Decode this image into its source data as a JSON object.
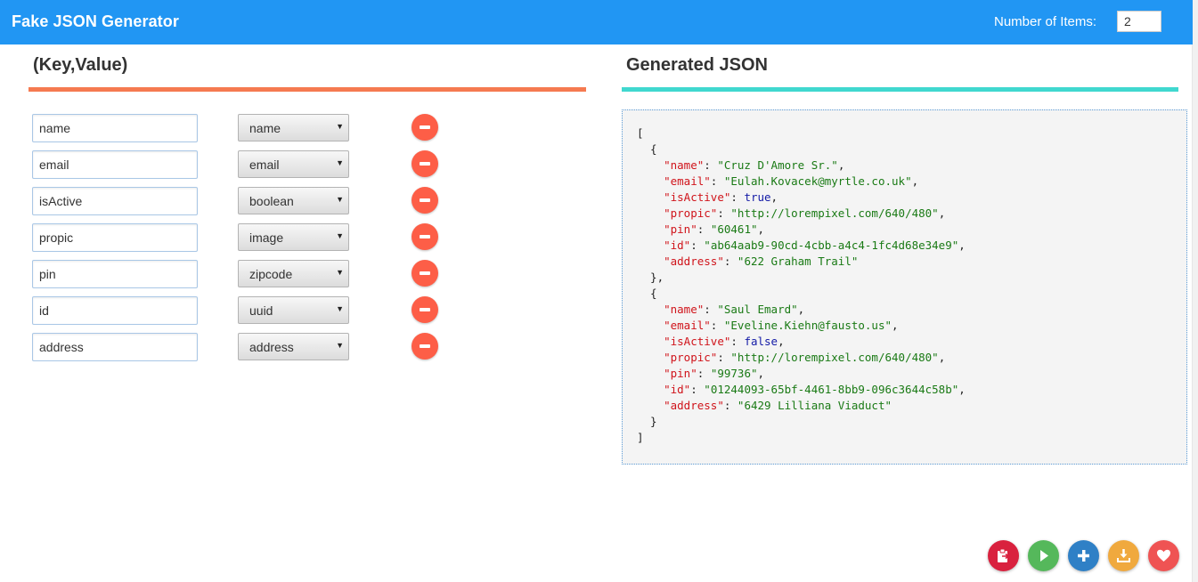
{
  "header": {
    "title": "Fake JSON Generator",
    "count_label": "Number of Items:",
    "count_value": "2"
  },
  "left": {
    "title": "(Key,Value)"
  },
  "right": {
    "title": "Generated JSON"
  },
  "fields": [
    {
      "key": "name",
      "type": "name"
    },
    {
      "key": "email",
      "type": "email"
    },
    {
      "key": "isActive",
      "type": "boolean"
    },
    {
      "key": "propic",
      "type": "image"
    },
    {
      "key": "pin",
      "type": "zipcode"
    },
    {
      "key": "id",
      "type": "uuid"
    },
    {
      "key": "address",
      "type": "address"
    }
  ],
  "json_items": [
    {
      "name": "Cruz D'Amore Sr.",
      "email": "Eulah.Kovacek@myrtle.co.uk",
      "isActive": true,
      "propic": "http://lorempixel.com/640/480",
      "pin": "60461",
      "id": "ab64aab9-90cd-4cbb-a4c4-1fc4d68e34e9",
      "address": "622 Graham Trail"
    },
    {
      "name": "Saul Emard",
      "email": "Eveline.Kiehn@fausto.us",
      "isActive": false,
      "propic": "http://lorempixel.com/640/480",
      "pin": "99736",
      "id": "01244093-65bf-4461-8bb9-096c3644c58b",
      "address": "6429 Lilliana Viaduct"
    }
  ],
  "actions": [
    {
      "name": "copy",
      "icon": "clipboard-icon",
      "color": "#d9213e"
    },
    {
      "name": "run",
      "icon": "play-icon",
      "color": "#55b85b"
    },
    {
      "name": "add",
      "icon": "plus-icon",
      "color": "#2f80c6"
    },
    {
      "name": "download",
      "icon": "download-icon",
      "color": "#f0a93e"
    },
    {
      "name": "favorite",
      "icon": "heart-icon",
      "color": "#ef5353"
    }
  ],
  "colors": {
    "appbar": "#2196f3",
    "left_bar": "#f57a50",
    "right_bar": "#40d8cf",
    "remove_button": "#fd5e47",
    "json_key": "#d0141b",
    "json_string": "#1a7a15",
    "json_boolean": "#1219a6"
  }
}
